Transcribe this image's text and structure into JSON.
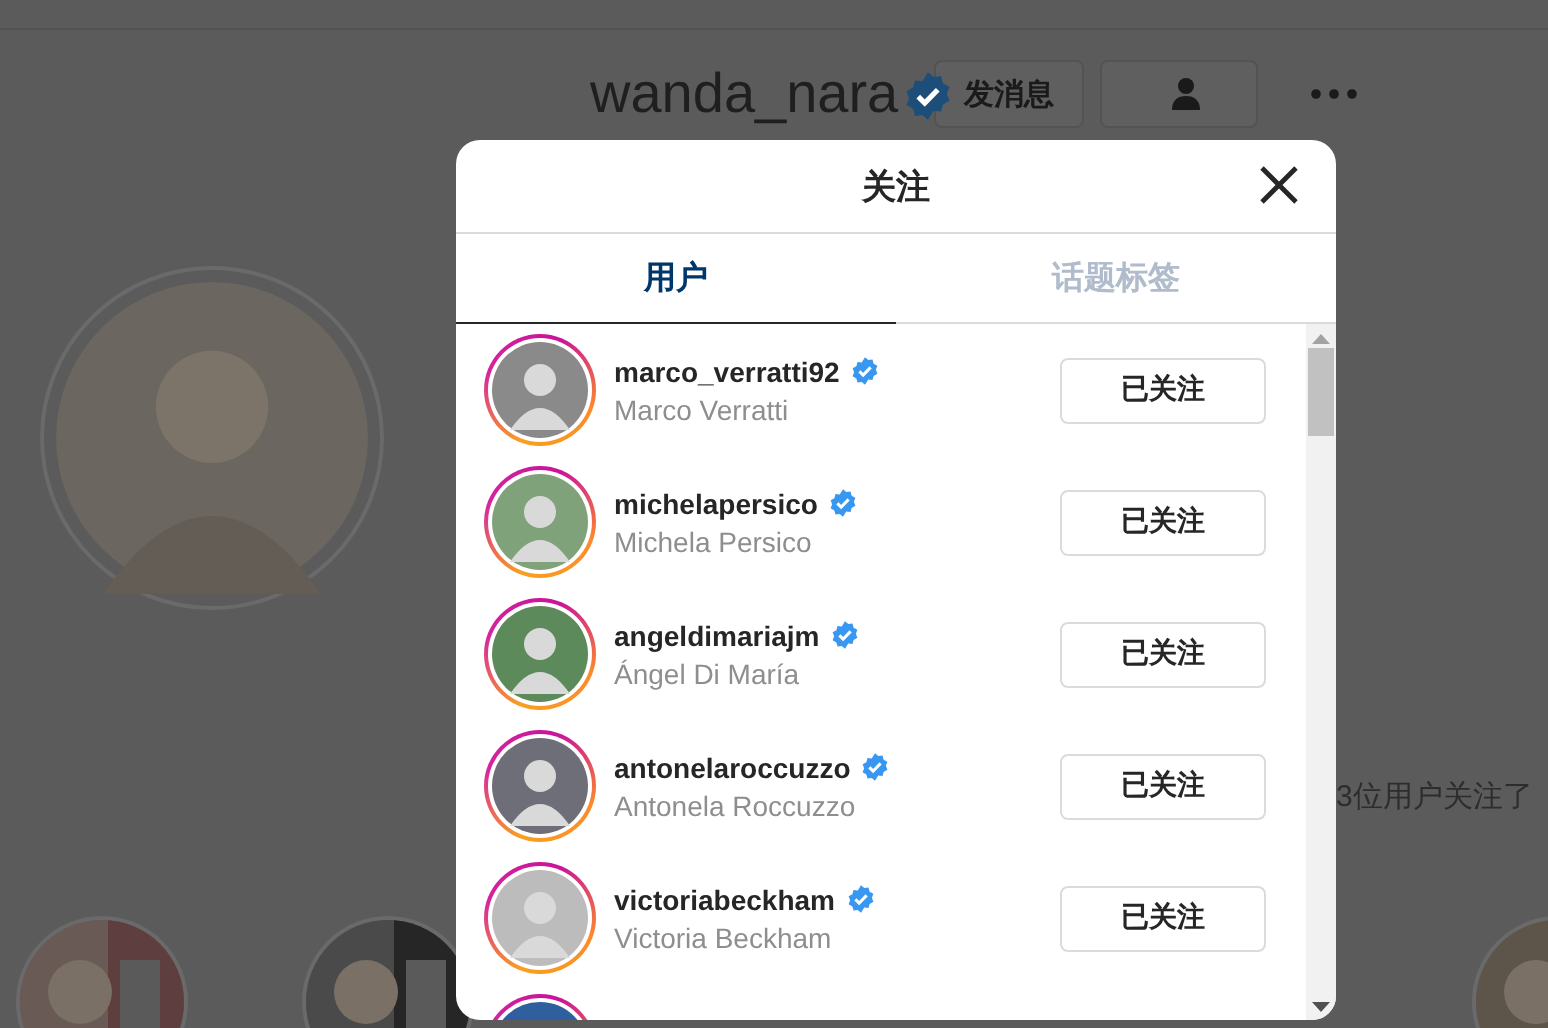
{
  "profile": {
    "username": "wanda_nara",
    "verified": true,
    "message_button": "发消息",
    "followed_by": "3位用户关注了"
  },
  "modal": {
    "title": "关注",
    "tabs": [
      {
        "label": "用户",
        "selected": true
      },
      {
        "label": "话题标签",
        "selected": false
      }
    ],
    "users": [
      {
        "username": "marco_verratti92",
        "full_name": "Marco Verratti",
        "verified": true,
        "button": "已关注"
      },
      {
        "username": "michelapersico",
        "full_name": "Michela Persico",
        "verified": true,
        "button": "已关注"
      },
      {
        "username": "angeldimariajm",
        "full_name": "Ángel Di María",
        "verified": true,
        "button": "已关注"
      },
      {
        "username": "antonelaroccuzzo",
        "full_name": "Antonela Roccuzzo",
        "verified": true,
        "button": "已关注"
      },
      {
        "username": "victoriabeckham",
        "full_name": "Victoria Beckham",
        "verified": true,
        "button": "已关注"
      }
    ],
    "more_below": true
  }
}
